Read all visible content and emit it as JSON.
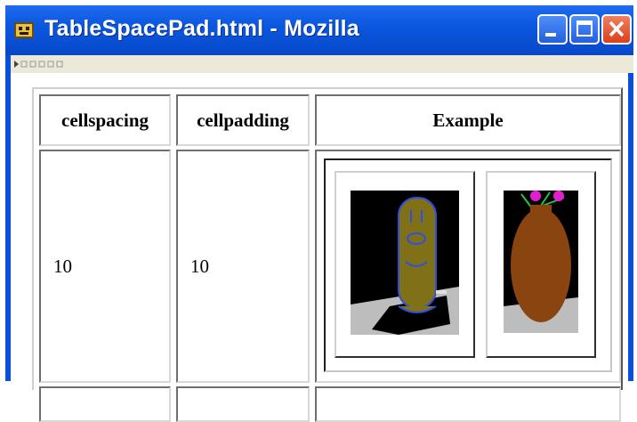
{
  "window": {
    "title": "TableSpacePad.html - Mozilla"
  },
  "icons": {
    "app": "mozilla-app-icon",
    "minimize": "minimize-icon",
    "maximize": "maximize-icon",
    "close": "close-icon"
  },
  "table": {
    "headers": [
      "cellspacing",
      "cellpadding",
      "Example"
    ],
    "rows": [
      {
        "cellspacing": "10",
        "cellpadding": "10"
      }
    ]
  },
  "colors": {
    "titlebar": "#0b58e0",
    "close_button": "#d8401c",
    "toolbar": "#ece9d8"
  }
}
